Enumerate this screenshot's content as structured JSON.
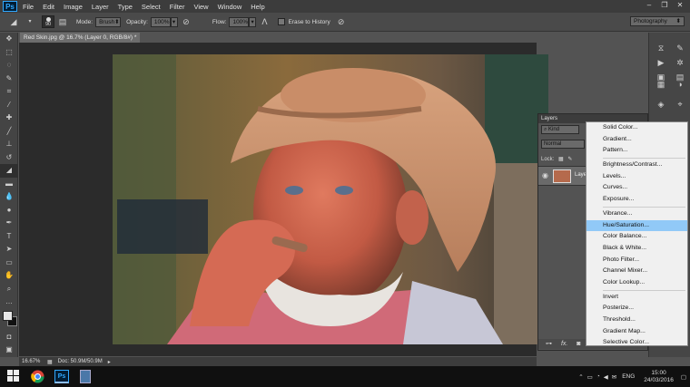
{
  "menubar": {
    "logo": "Ps",
    "items": [
      "File",
      "Edit",
      "Image",
      "Layer",
      "Type",
      "Select",
      "Filter",
      "View",
      "Window",
      "Help"
    ],
    "window_controls": [
      "–",
      "❐",
      "✕"
    ]
  },
  "optbar": {
    "brush_size": "90",
    "mode_label": "Mode:",
    "mode_value": "Brush",
    "opacity_label": "Opacity:",
    "opacity_value": "100%",
    "flow_label": "Flow:",
    "flow_value": "100%",
    "erase_to_history": "Erase to History",
    "workspace": "Photography"
  },
  "document": {
    "tab_title": "Red Skin.jpg @ 16.7% (Layer 0, RGB/8#) * ×",
    "zoom": "16.67%",
    "doc_size": "Doc: 50.9M/50.9M"
  },
  "layers_panel": {
    "title": "Layers",
    "filter": "Kind",
    "blend_mode": "Normal",
    "lock_label": "Lock:",
    "layer_name": "Laye",
    "footer_icons": [
      "link-icon",
      "fx-icon",
      "mask-icon"
    ]
  },
  "adjustment_menu": {
    "items": [
      {
        "label": "Solid Color...",
        "group": 1
      },
      {
        "label": "Gradient...",
        "group": 1
      },
      {
        "label": "Pattern...",
        "group": 1
      },
      {
        "label": "Brightness/Contrast...",
        "group": 2
      },
      {
        "label": "Levels...",
        "group": 2
      },
      {
        "label": "Curves...",
        "group": 2
      },
      {
        "label": "Exposure...",
        "group": 2
      },
      {
        "label": "Vibrance...",
        "group": 3
      },
      {
        "label": "Hue/Saturation...",
        "group": 3,
        "highlighted": true
      },
      {
        "label": "Color Balance...",
        "group": 3
      },
      {
        "label": "Black & White...",
        "group": 3
      },
      {
        "label": "Photo Filter...",
        "group": 3
      },
      {
        "label": "Channel Mixer...",
        "group": 3
      },
      {
        "label": "Color Lookup...",
        "group": 3
      },
      {
        "label": "Invert",
        "group": 4
      },
      {
        "label": "Posterize...",
        "group": 4
      },
      {
        "label": "Threshold...",
        "group": 4
      },
      {
        "label": "Gradient Map...",
        "group": 4
      },
      {
        "label": "Selective Color...",
        "group": 4
      }
    ]
  },
  "taskbar": {
    "language": "ENG",
    "time": "15:00",
    "date": "24/03/2016"
  },
  "colors": {
    "highlight": "#91c9f7",
    "ps_blue": "#31a8ff"
  }
}
